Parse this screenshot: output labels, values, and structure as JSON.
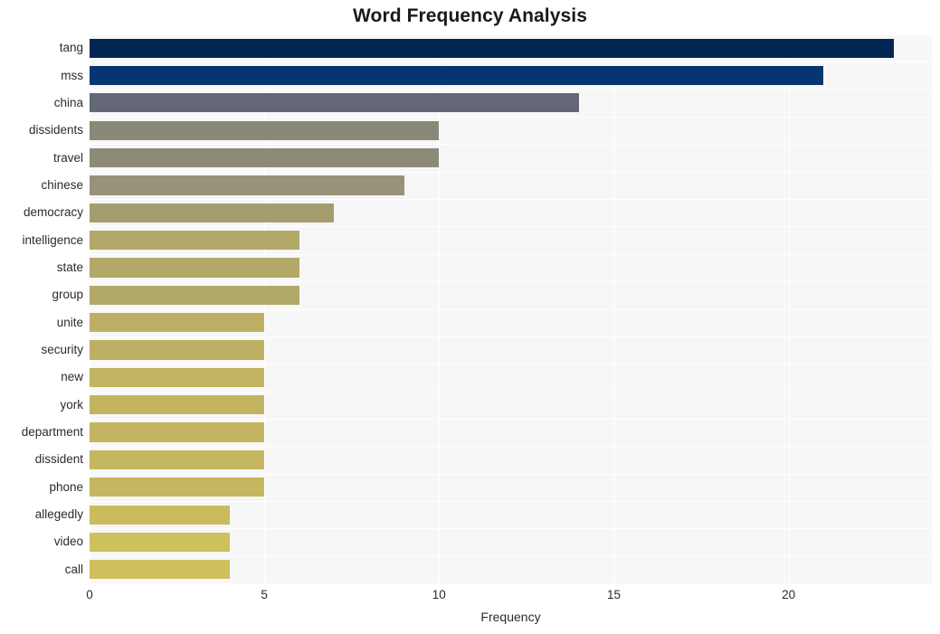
{
  "chart_data": {
    "type": "bar",
    "orientation": "horizontal",
    "title": "Word Frequency Analysis",
    "xlabel": "Frequency",
    "ylabel": "",
    "categories": [
      "tang",
      "mss",
      "china",
      "dissidents",
      "travel",
      "chinese",
      "democracy",
      "intelligence",
      "state",
      "group",
      "unite",
      "security",
      "new",
      "york",
      "department",
      "dissident",
      "phone",
      "allegedly",
      "video",
      "call"
    ],
    "values": [
      23,
      21,
      14,
      10,
      10,
      9,
      7,
      6,
      6,
      6,
      5,
      5,
      5,
      5,
      5,
      5,
      5,
      4,
      4,
      4
    ],
    "bar_colors": [
      "#002651",
      "#073572",
      "#646876",
      "#8a8878",
      "#8d8a78",
      "#979279",
      "#a59d70",
      "#b2a868",
      "#b2a868",
      "#b2a868",
      "#bcaf64",
      "#bcaf64",
      "#c2b461",
      "#c2b461",
      "#c2b461",
      "#c5b660",
      "#c5b660",
      "#cabb5e",
      "#cdc05d",
      "#cdc05d"
    ],
    "xlim": [
      0,
      24.1
    ],
    "xticks": [
      0,
      5,
      10,
      15,
      20
    ],
    "xtick_labels": [
      "0",
      "5",
      "10",
      "15",
      "20"
    ],
    "grid": true,
    "grid_color": "#ffffff",
    "plot_background": "#f7f7f7",
    "figure_background": "#ffffff",
    "legend": null
  }
}
